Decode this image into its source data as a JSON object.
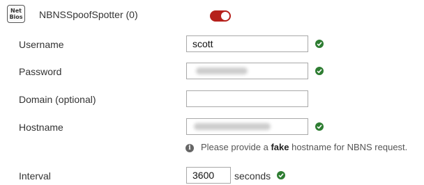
{
  "plugin": {
    "badge_line1": "Net",
    "badge_line2": "Bios",
    "title": "NBNSSpoofSpotter (0)",
    "enabled": true,
    "toggle_color": "#b5201b"
  },
  "form": {
    "username": {
      "label": "Username",
      "value": "scott",
      "valid": true
    },
    "password": {
      "label": "Password",
      "value": "",
      "valid": true
    },
    "domain": {
      "label": "Domain (optional)",
      "value": "",
      "valid": false
    },
    "hostname": {
      "label": "Hostname",
      "value": "",
      "valid": true
    },
    "hostname_hint": {
      "icon": "info-circle-icon",
      "prefix": "Please provide a ",
      "bold": "fake",
      "suffix": " hostname for NBNS request."
    },
    "interval": {
      "label": "Interval",
      "value": "3600",
      "unit": "seconds",
      "valid": true
    }
  },
  "colors": {
    "check": "#2e7d32",
    "text": "#333333"
  }
}
